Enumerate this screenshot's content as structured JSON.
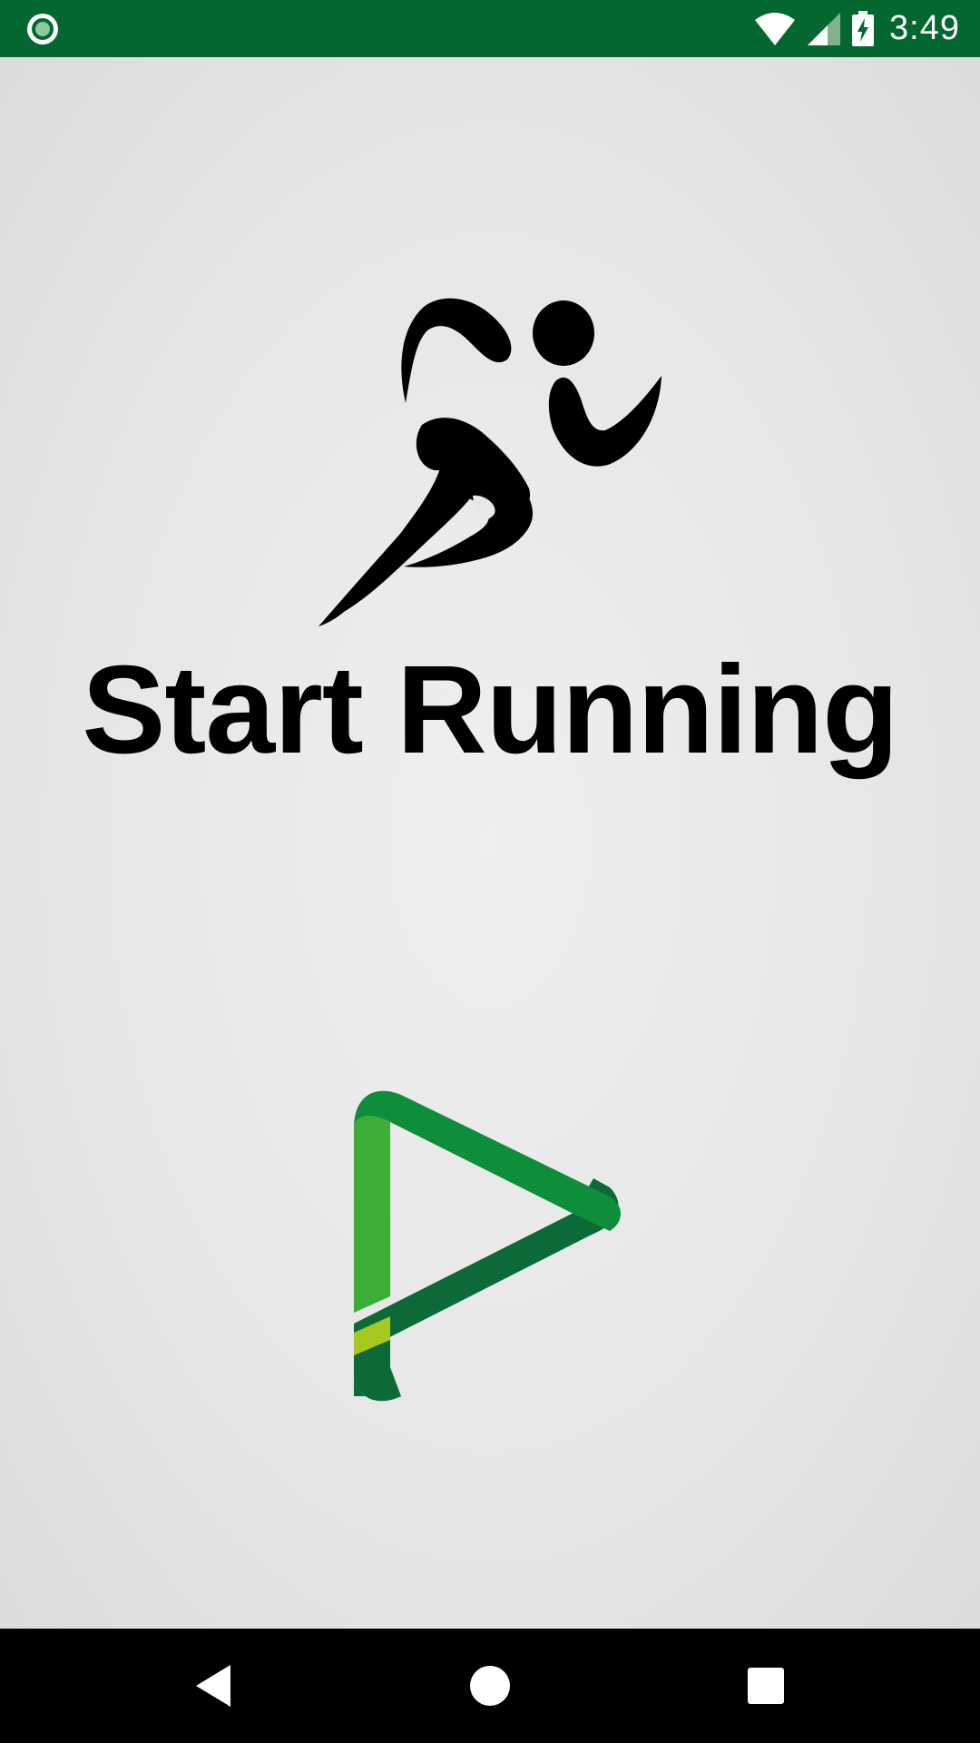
{
  "status_bar": {
    "time": "3:49",
    "icons": [
      "notification-dot-icon",
      "wifi-icon",
      "cell-signal-icon",
      "battery-charging-icon"
    ],
    "background_color": "#03672f"
  },
  "main": {
    "title": "Start Running",
    "runner_icon": "runner-icon",
    "start_button_icon": "play-icon",
    "colors": {
      "play_dark_green": "#0b6a35",
      "play_mid_green": "#0e8e3a",
      "play_light_green": "#3dad35",
      "play_lime": "#a6c81f"
    }
  },
  "nav_bar": {
    "buttons": [
      "back-icon",
      "home-icon",
      "recents-icon"
    ]
  }
}
